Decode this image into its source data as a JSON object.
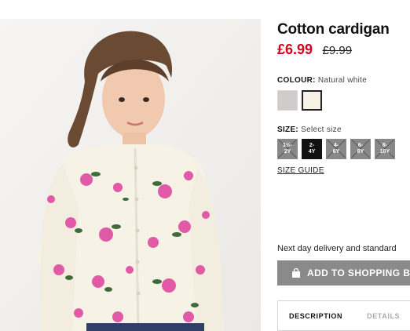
{
  "product": {
    "title": "Cotton cardigan",
    "price_current": "£6.99",
    "price_original": "£9.99"
  },
  "colour": {
    "label": "COLOUR:",
    "selected": "Natural white",
    "swatches": [
      {
        "name": "Grey",
        "color": "#cfcccb",
        "selected": false
      },
      {
        "name": "Natural white",
        "color": "#f7f2e6",
        "selected": true
      }
    ]
  },
  "size": {
    "label": "SIZE:",
    "prompt": "Select size",
    "options": [
      {
        "line1": "1½-",
        "line2": "2Y",
        "available": false,
        "selected": false
      },
      {
        "line1": "2-",
        "line2": "4Y",
        "available": true,
        "selected": true
      },
      {
        "line1": "4-",
        "line2": "6Y",
        "available": false,
        "selected": false
      },
      {
        "line1": "6-",
        "line2": "8Y",
        "available": false,
        "selected": false
      },
      {
        "line1": "8-",
        "line2": "10Y",
        "available": false,
        "selected": false
      }
    ],
    "guide_link": "SIZE GUIDE"
  },
  "delivery_text": "Next day delivery and standard",
  "add_button": {
    "label": "ADD TO SHOPPING BAG",
    "icon": "shopping-bag-icon"
  },
  "tabs": [
    {
      "label": "DESCRIPTION",
      "active": true
    },
    {
      "label": "DETAILS",
      "active": false
    }
  ],
  "colors": {
    "sale_price": "#d6001c",
    "button_bg": "#8a8a8a",
    "size_selected": "#111111",
    "size_unavailable": "#888888"
  }
}
